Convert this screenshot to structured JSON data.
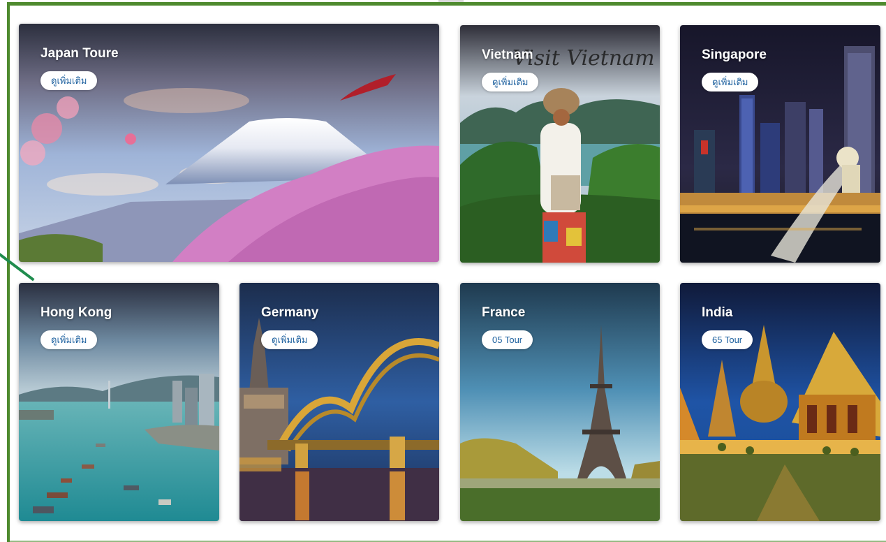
{
  "colors": {
    "frame": "#4e8a2e",
    "accent_line": "#1f8c4e",
    "pill_bg": "#ffffff",
    "pill_text": "#1b5f9e",
    "title_text": "#ffffff"
  },
  "destinations": [
    {
      "id": "japan",
      "title": "Japan Toure",
      "button": "ดูเพิ่มเติม"
    },
    {
      "id": "vietnam",
      "title": "Vietnam",
      "button": "ดูเพิ่มเติม",
      "overlay_script": "Visit Vietnam"
    },
    {
      "id": "singapore",
      "title": "Singapore",
      "button": "ดูเพิ่มเติม"
    },
    {
      "id": "hongkong",
      "title": "Hong Kong",
      "button": "ดูเพิ่มเติม"
    },
    {
      "id": "germany",
      "title": "Germany",
      "button": "ดูเพิ่มเติม"
    },
    {
      "id": "france",
      "title": "France",
      "button": "05 Tour"
    },
    {
      "id": "india",
      "title": "India",
      "button": "65 Tour"
    }
  ]
}
